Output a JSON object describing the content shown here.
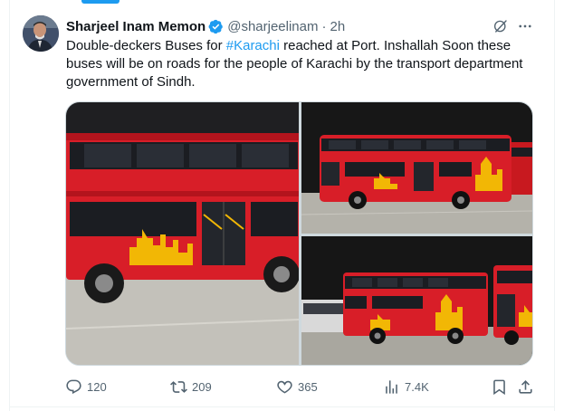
{
  "tweet": {
    "author": {
      "display_name": "Sharjeel Inam Memon",
      "handle": "@sharjeelinam",
      "verified": true,
      "avatar_icon": "user-avatar"
    },
    "separator": "·",
    "time": "2h",
    "text_before": "Double-deckers Buses for ",
    "hashtag": "#Karachi",
    "text_after": " reached at Port. Inshallah Soon these buses will be on roads for the people of Karachi by the transport department government of Sindh.",
    "media": [
      {
        "icon": "photo-bus-closeup"
      },
      {
        "icon": "photo-bus-side"
      },
      {
        "icon": "photo-buses-parked"
      }
    ],
    "actions": {
      "replies": "120",
      "reposts": "209",
      "likes": "365",
      "views": "7.4K"
    }
  },
  "colors": {
    "accent": "#1d9bf0",
    "text_primary": "#0f1419",
    "text_secondary": "#536471",
    "border": "#cfd9de",
    "bus_red": "#d81e28",
    "bus_yellow": "#f2b705"
  }
}
